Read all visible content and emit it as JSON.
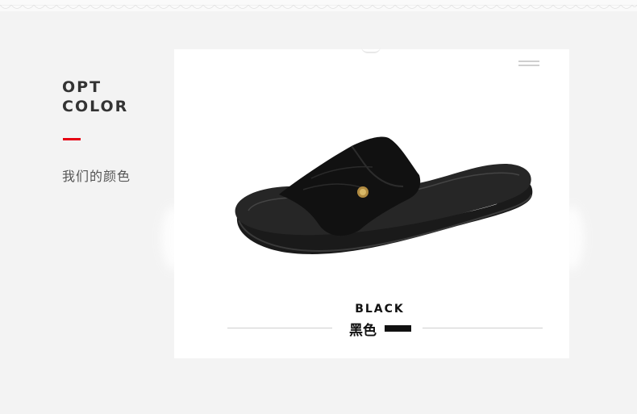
{
  "heading": {
    "line1": "OPT",
    "line2": "COLOR",
    "subtitle": "我们的颜色"
  },
  "colors": {
    "accent": "#e60012",
    "background": "#f3f3f3",
    "card": "#ffffff",
    "swatch": "#111111"
  },
  "product": {
    "color_name_en": "BLACK",
    "color_name_cn": "黑色",
    "image": "black-slide-sandal"
  },
  "icons": [
    "menu-icon"
  ]
}
